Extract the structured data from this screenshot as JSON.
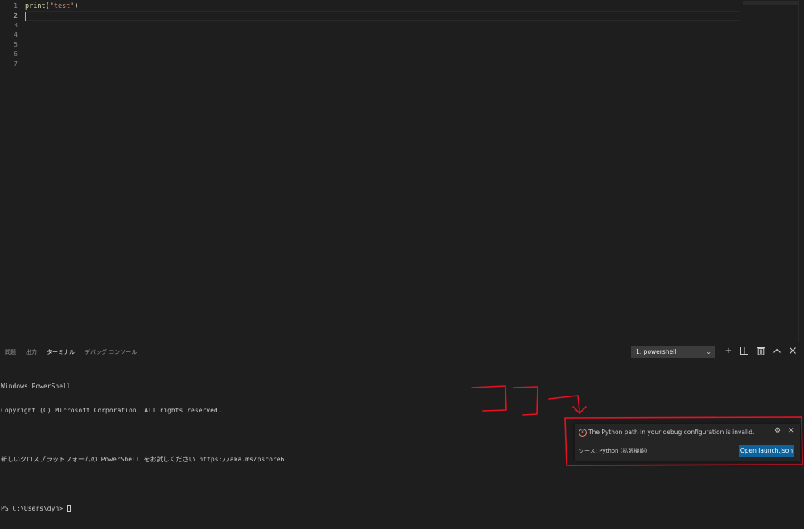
{
  "editor": {
    "line_numbers": [
      "1",
      "2",
      "3",
      "4",
      "5",
      "6",
      "7"
    ],
    "active_line": "2",
    "code": {
      "fn": "print",
      "open": "(",
      "str": "\"test\"",
      "close": ")"
    }
  },
  "panel": {
    "tabs": [
      "問題",
      "出力",
      "ターミナル",
      "デバッグ コンソール"
    ],
    "active_tab": "ターミナル",
    "terminal_select": "1: powershell",
    "tools": [
      "plus-icon",
      "split-icon",
      "trash-icon",
      "chevron-up-icon",
      "close-icon"
    ],
    "terminal_lines": [
      "Windows PowerShell",
      "Copyright (C) Microsoft Corporation. All rights reserved.",
      "新しいクロスプラットフォームの PowerShell をお試しください https://aka.ms/pscore6",
      "PS C:\\Users\\dyn> "
    ]
  },
  "notification": {
    "message": "The Python path in your debug configuration is invalid.",
    "source": "ソース: Python (拡張機能)",
    "button": "Open launch.json",
    "error_color": "#f48771",
    "button_color": "#0e639c"
  },
  "annotation": {
    "text": "ココ",
    "color": "#e81123"
  }
}
